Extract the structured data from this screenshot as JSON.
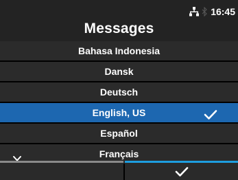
{
  "header": {
    "title": "Messages",
    "time": "16:45",
    "icons": [
      "network-icon",
      "bluetooth-icon"
    ]
  },
  "languages": [
    {
      "label": "Bahasa Indonesia",
      "selected": false
    },
    {
      "label": "Dansk",
      "selected": false
    },
    {
      "label": "Deutsch",
      "selected": false
    },
    {
      "label": "English, US",
      "selected": true
    },
    {
      "label": "Español",
      "selected": false
    },
    {
      "label": "Français",
      "selected": false
    }
  ],
  "footer": {
    "left_button_icon": "",
    "right_button_icon": "checkmark-icon"
  },
  "colors": {
    "selected_row": "#1d67b0",
    "row": "#2b2b2b",
    "header": "#232323",
    "ok_accent": "#1e9ee0"
  }
}
